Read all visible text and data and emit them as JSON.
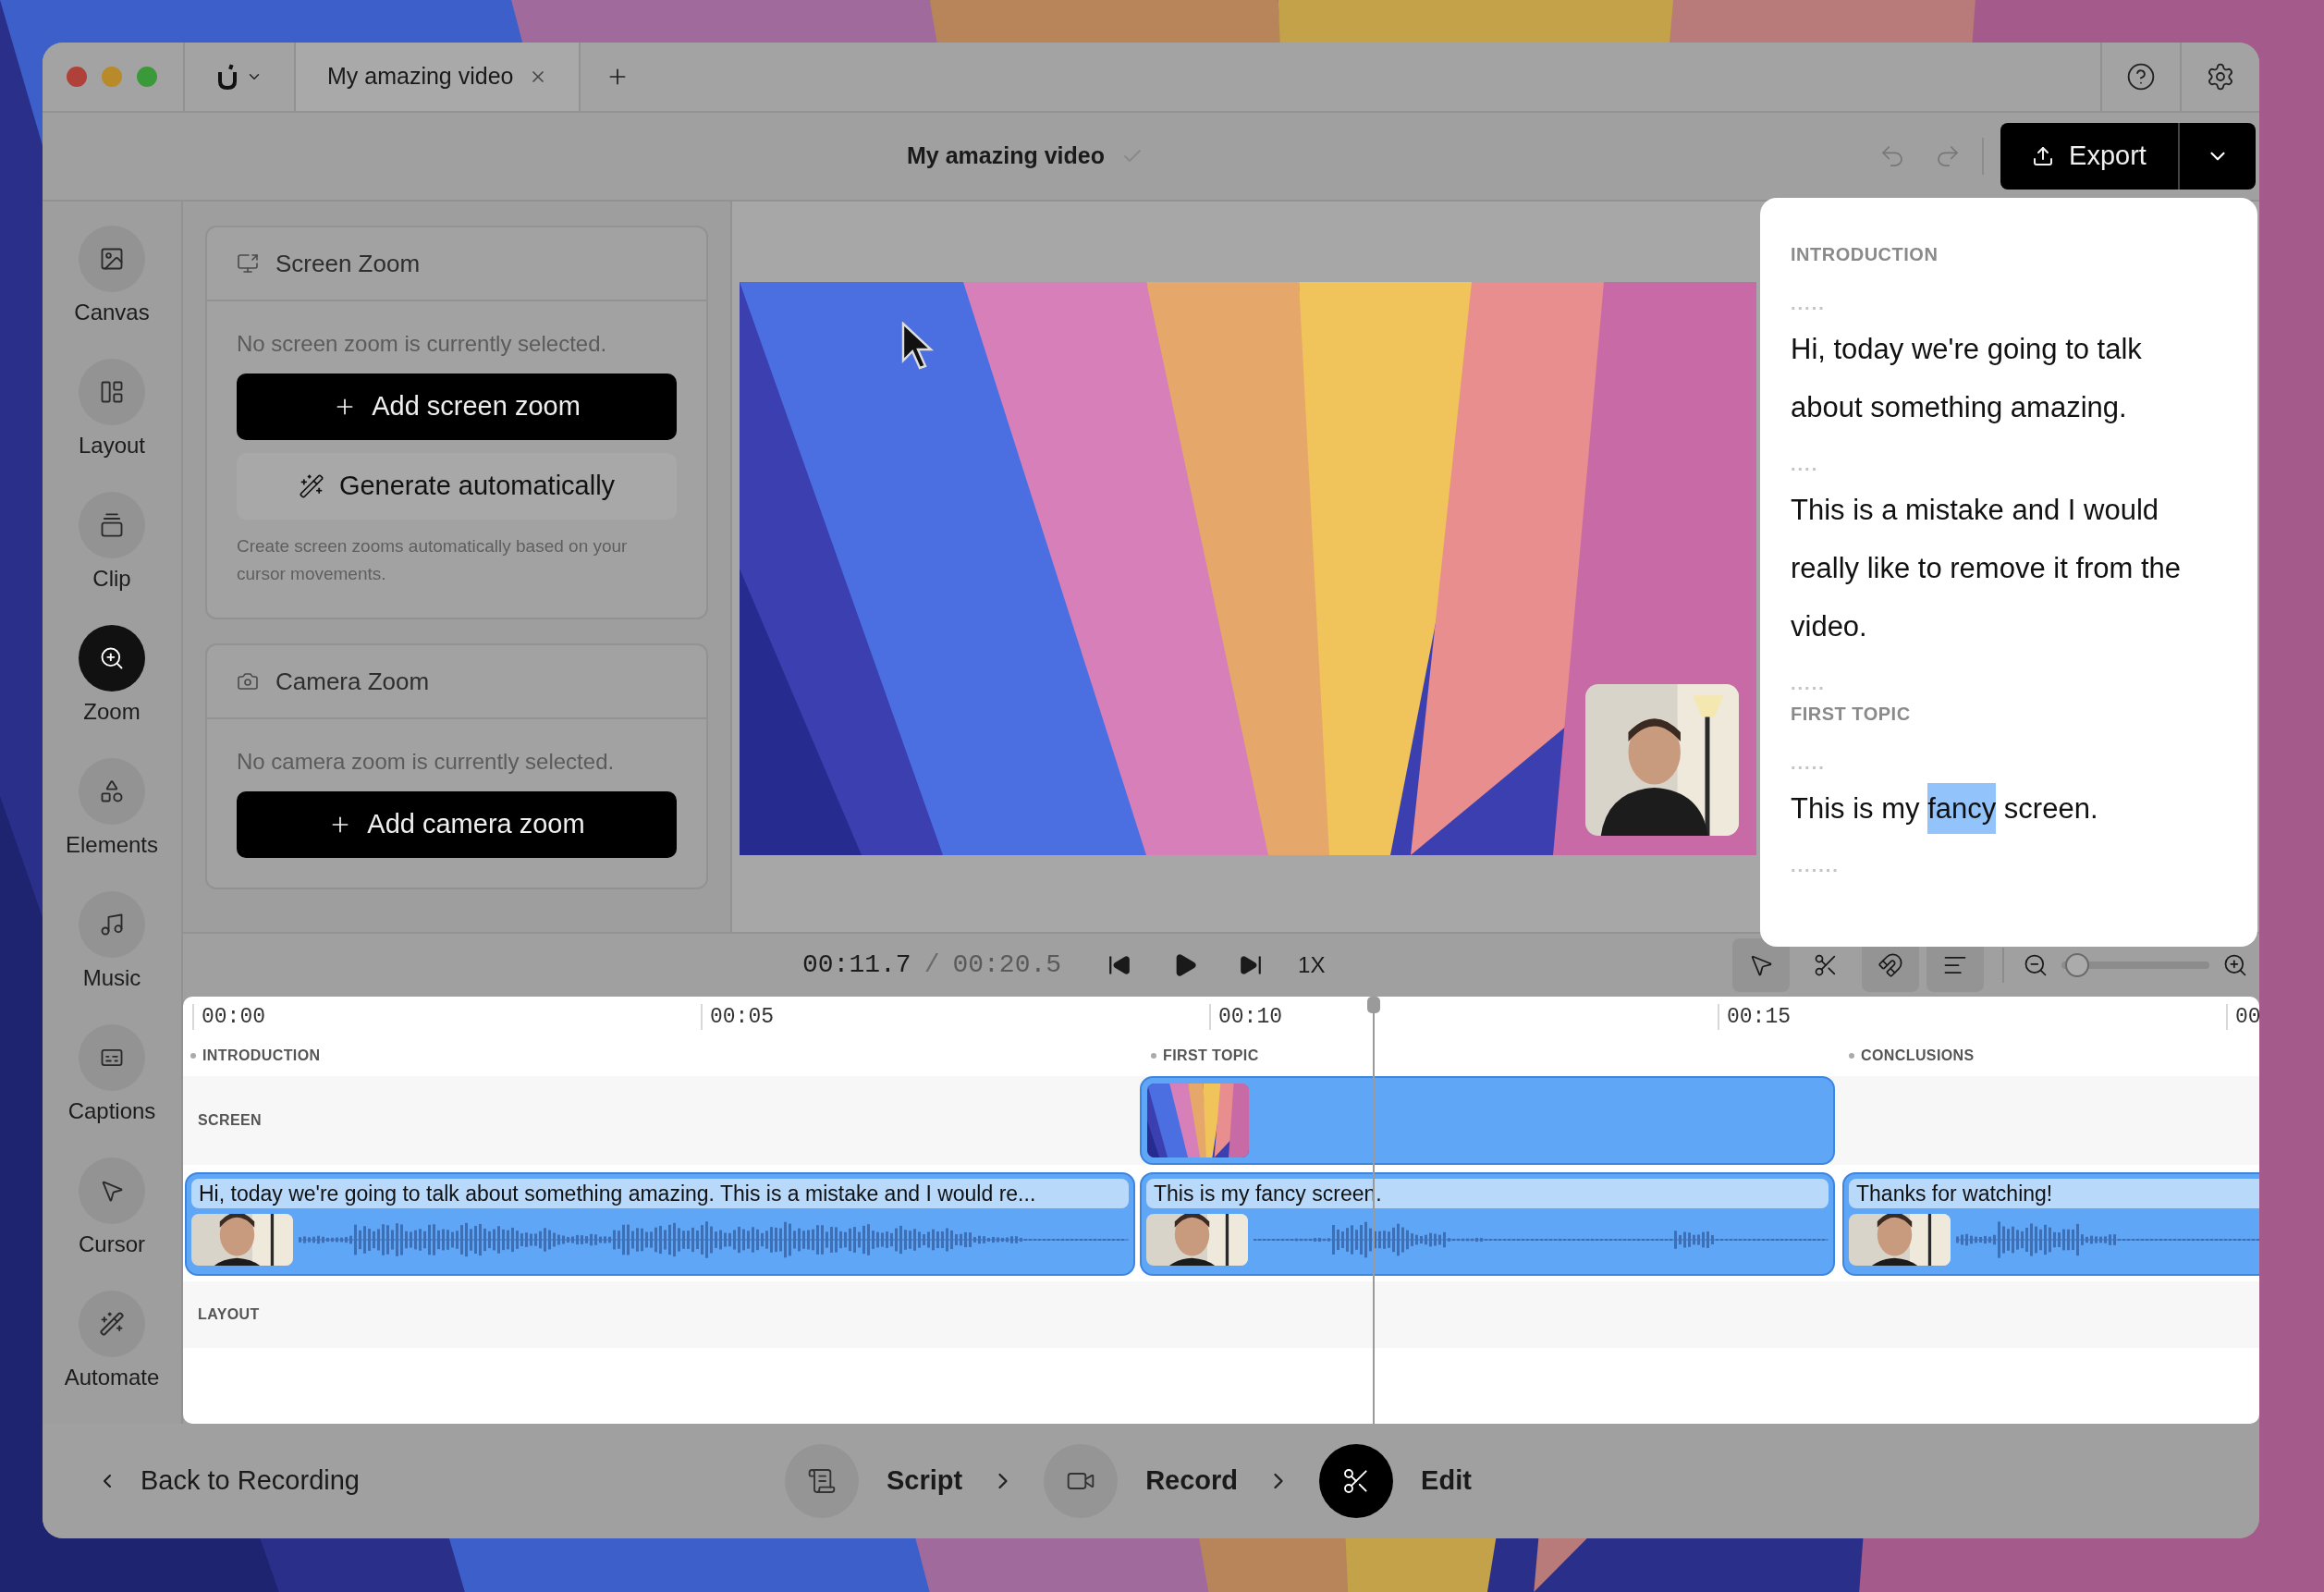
{
  "title_bar": {
    "tab": {
      "label": "My amazing video",
      "selected": true
    }
  },
  "toolbar": {
    "title": "My amazing video",
    "export_button": "Export"
  },
  "sidebar": {
    "items": [
      {
        "label": "Canvas",
        "selected": false
      },
      {
        "label": "Layout",
        "selected": false
      },
      {
        "label": "Clip",
        "selected": false
      },
      {
        "label": "Zoom",
        "selected": true
      },
      {
        "label": "Elements",
        "selected": false
      },
      {
        "label": "Music",
        "selected": false
      },
      {
        "label": "Captions",
        "selected": false
      },
      {
        "label": "Cursor",
        "selected": false
      },
      {
        "label": "Automate",
        "selected": false
      }
    ]
  },
  "screen_zoom": {
    "title": "Screen Zoom",
    "message": "No screen zoom is currently selected.",
    "add_button": "Add screen zoom",
    "generate_button": "Generate automatically",
    "hint": "Create screen zooms automatically based on your cursor movements."
  },
  "camera_zoom": {
    "title": "Camera Zoom",
    "message": "No camera zoom is currently selected.",
    "add_button": "Add camera zoom"
  },
  "script": [
    {
      "kind": "section",
      "text": "INTRODUCTION"
    },
    {
      "kind": "pause",
      "text": "....."
    },
    {
      "kind": "text",
      "parts": [
        {
          "text": "Hi, today we're going to talk about something amazing.",
          "highlighted": false
        }
      ]
    },
    {
      "kind": "pause",
      "text": "...."
    },
    {
      "kind": "text",
      "parts": [
        {
          "text": "This is a mistake and I would really like to remove it from the video.",
          "highlighted": false
        }
      ]
    },
    {
      "kind": "pause",
      "text": "....."
    },
    {
      "kind": "section",
      "text": "FIRST TOPIC"
    },
    {
      "kind": "pause",
      "text": "....."
    },
    {
      "kind": "text",
      "parts": [
        {
          "text": "This is my ",
          "highlighted": false
        },
        {
          "text": "fancy",
          "highlighted": true
        },
        {
          "text": " screen.",
          "highlighted": false
        }
      ]
    },
    {
      "kind": "pause",
      "text": "......."
    }
  ],
  "playback": {
    "current": "00:11.7",
    "separator": "/",
    "total": "00:20.5",
    "speed": "1X"
  },
  "tools": [
    {
      "kind": "select",
      "selected": true
    },
    {
      "kind": "cut",
      "selected": false
    },
    {
      "kind": "magnet",
      "selected": true
    },
    {
      "kind": "align",
      "selected": true
    }
  ],
  "zoom_slider": {
    "level": 0.03
  },
  "timeline": {
    "ticks": [
      "00:00",
      "00:05",
      "00:10",
      "00:15",
      "00"
    ],
    "playhead": {
      "level": 0.564
    },
    "sections": [
      "INTRODUCTION",
      "FIRST TOPIC",
      "CONCLUSIONS"
    ],
    "screen_track": "SCREEN",
    "layout_track": "LAYOUT",
    "clips": [
      {
        "caption": "Hi, today we're going to talk about something amazing. This is a mistake and I would re..."
      },
      {
        "caption": "This is my fancy screen."
      },
      {
        "caption": "Thanks for watching!"
      }
    ]
  },
  "bottom_bar": {
    "back_button": "Back to Recording",
    "steps": [
      {
        "label": "Script",
        "selected": false
      },
      {
        "label": "Record",
        "selected": false
      },
      {
        "label": "Edit",
        "selected": true
      }
    ]
  }
}
